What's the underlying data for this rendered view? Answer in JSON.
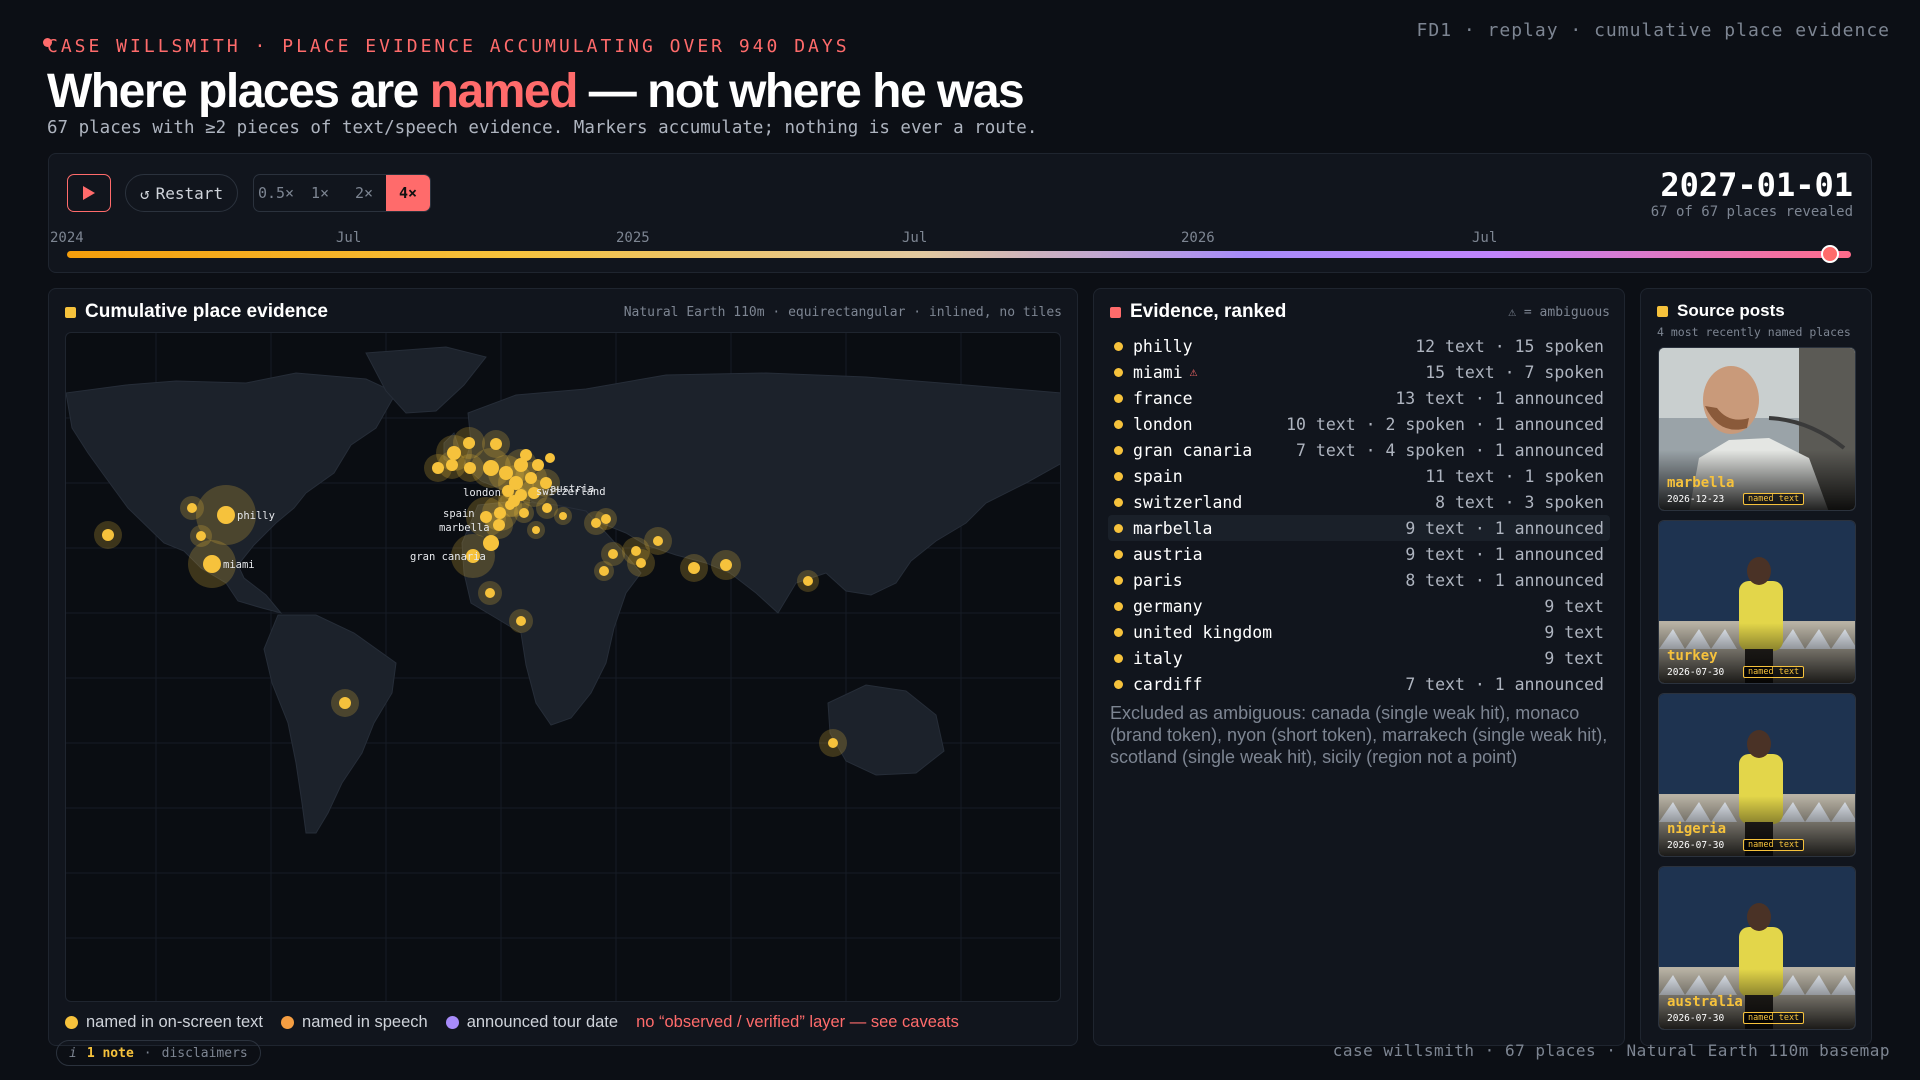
{
  "header": {
    "kicker": "CASE WILLSMITH · PLACE EVIDENCE ACCUMULATING OVER 940 DAYS",
    "top_right": "FD1 · replay · cumulative place evidence",
    "title_pre": "Where places are ",
    "title_highlight": "named",
    "title_post": " — not where he was",
    "subtitle": "67 places with ≥2 pieces of text/speech evidence. Markers accumulate; nothing is ever a route."
  },
  "timeline": {
    "restart_label": "Restart",
    "restart_icon": "↺",
    "speeds": [
      "0.5×",
      "1×",
      "2×",
      "4×"
    ],
    "active_speed": "4×",
    "current_date": "2027-01-01",
    "revealed": "67 of 67 places revealed",
    "progress": 1.0,
    "ticks": [
      "2024",
      "Jul",
      "2025",
      "Jul",
      "2026",
      "Jul"
    ]
  },
  "map": {
    "title": "Cumulative place evidence",
    "note": "Natural Earth 110m · equirectangular · inlined, no tiles",
    "labels": [
      "philly",
      "miami",
      "spain",
      "marbella",
      "gran canaria",
      "austria",
      "switzerland",
      "london"
    ],
    "legend": {
      "onscreen": "named in on-screen text",
      "speech": "named in speech",
      "announced": "announced tour date",
      "warning": "no “observed / verified” layer — see caveats"
    },
    "colors": {
      "text": "#f6c23c",
      "speech": "#f59e42",
      "announced": "#a78bfa",
      "warning": "#ff6b6b"
    }
  },
  "evidence": {
    "title": "Evidence, ranked",
    "ambiguous_note": "⚠ = ambiguous",
    "rows": [
      {
        "name": "philly",
        "counts": "12 text · 15 spoken",
        "warn": ""
      },
      {
        "name": "miami",
        "counts": "15 text · 7 spoken",
        "warn": "⚠"
      },
      {
        "name": "france",
        "counts": "13 text · 1 announced",
        "warn": ""
      },
      {
        "name": "london",
        "counts": "10 text · 2 spoken · 1 announced",
        "warn": ""
      },
      {
        "name": "gran canaria",
        "counts": "7 text · 4 spoken · 1 announced",
        "warn": ""
      },
      {
        "name": "spain",
        "counts": "11 text · 1 spoken",
        "warn": ""
      },
      {
        "name": "switzerland",
        "counts": "8 text · 3 spoken",
        "warn": ""
      },
      {
        "name": "marbella",
        "counts": "9 text · 1 announced",
        "warn": ""
      },
      {
        "name": "austria",
        "counts": "9 text · 1 announced",
        "warn": ""
      },
      {
        "name": "paris",
        "counts": "8 text · 1 announced",
        "warn": ""
      },
      {
        "name": "germany",
        "counts": "9 text",
        "warn": ""
      },
      {
        "name": "united kingdom",
        "counts": "9 text",
        "warn": ""
      },
      {
        "name": "italy",
        "counts": "9 text",
        "warn": ""
      },
      {
        "name": "cardiff",
        "counts": "7 text · 1 announced",
        "warn": ""
      }
    ],
    "excluded": "Excluded as ambiguous: canada (single weak hit), monaco (brand token), nyon (short token), marrakech (single weak hit), scotland (single weak hit), sicily (region not a point)"
  },
  "sources": {
    "title": "Source posts",
    "subtitle": "4 most recently named places",
    "badge": "named text",
    "posts": [
      {
        "place": "marbella",
        "date": "2026-12-23"
      },
      {
        "place": "turkey",
        "date": "2026-07-30"
      },
      {
        "place": "nigeria",
        "date": "2026-07-30"
      },
      {
        "place": "australia",
        "date": "2026-07-30"
      }
    ]
  },
  "footer": {
    "note_icon": "i",
    "note_label": "1 note",
    "disclaimers": "disclaimers",
    "right": "case willsmith · 67 places · Natural Earth 110m basemap"
  }
}
